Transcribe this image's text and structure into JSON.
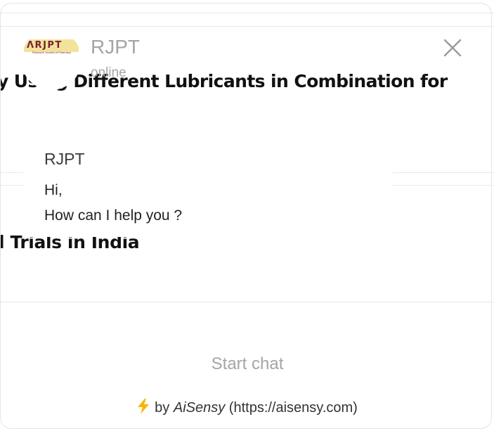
{
  "background_page": {
    "article_title_1": "y Using Different Lubricants in Combination for",
    "article_title_2": "l Trials in India"
  },
  "widget": {
    "header": {
      "avatar_logo_text": "ΛRJPT",
      "avatar_logo_subtext": "Research Journal of Pharmacy",
      "name": "RJPT",
      "status": "online",
      "close_icon": "close-icon"
    },
    "message": {
      "sender": "RJPT",
      "lines": [
        "Hi,",
        "How can I help you ?"
      ]
    },
    "start_chat_label": "Start chat",
    "powered_by": {
      "bolt_icon": "lightning-bolt-icon",
      "prefix": "by",
      "brand": "AiSensy",
      "suffix": "(https://aisensy.com)"
    }
  },
  "colors": {
    "muted_text": "#a5a5a5",
    "bolt": "#f7b500",
    "divider": "#e6e6e6"
  }
}
